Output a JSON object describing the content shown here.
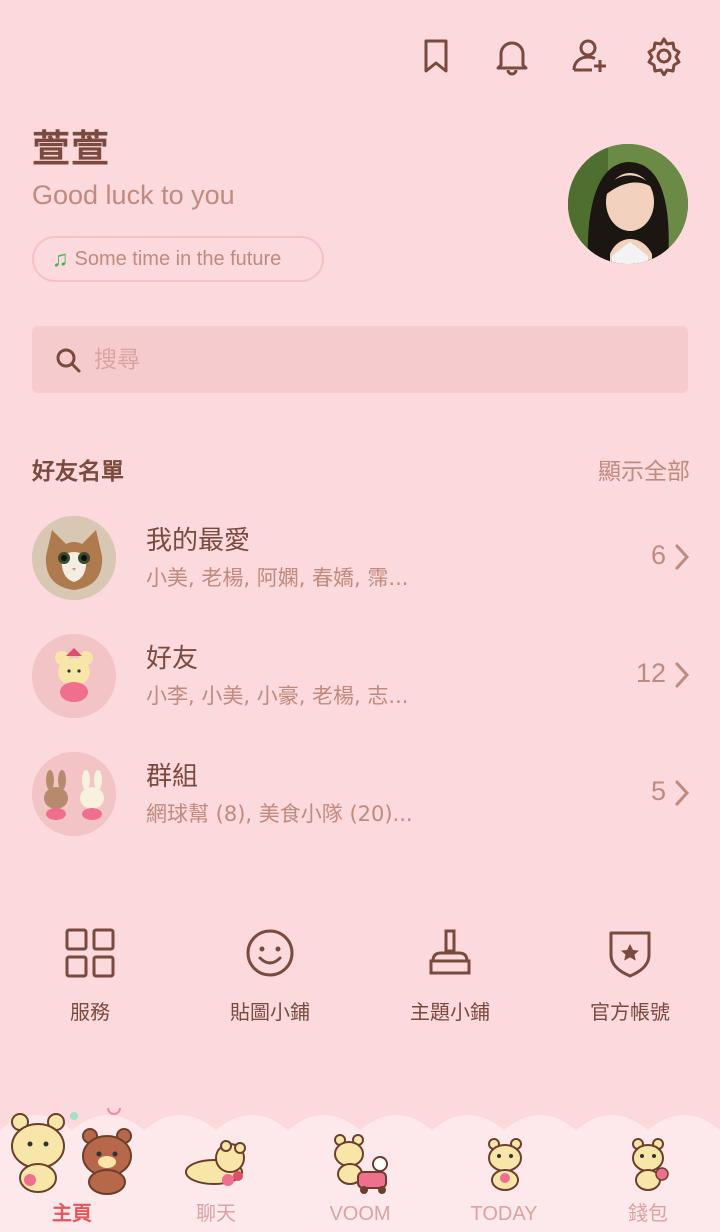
{
  "header": {
    "icons": [
      "bookmark-icon",
      "bell-icon",
      "add-friend-icon",
      "gear-icon"
    ]
  },
  "profile": {
    "name": "萱萱",
    "status": "Good luck to you",
    "music": "Some time in the future"
  },
  "search": {
    "placeholder": "搜尋"
  },
  "friends_section": {
    "title": "好友名單",
    "show_all": "顯示全部",
    "rows": [
      {
        "title": "我的最愛",
        "sub": "小美, 老楊, 阿嫻, 春嬌, 霈...",
        "count": "6"
      },
      {
        "title": "好友",
        "sub": "小李, 小美, 小豪, 老楊, 志...",
        "count": "12"
      },
      {
        "title": "群組",
        "sub": "網球幫 (8), 美食小隊 (20)...",
        "count": "5"
      }
    ]
  },
  "services": [
    {
      "label": "服務",
      "icon": "grid-icon"
    },
    {
      "label": "貼圖小鋪",
      "icon": "smile-icon"
    },
    {
      "label": "主題小鋪",
      "icon": "brush-icon"
    },
    {
      "label": "官方帳號",
      "icon": "shield-star-icon"
    }
  ],
  "bottom_nav": [
    {
      "label": "主頁",
      "active": true
    },
    {
      "label": "聊天",
      "active": false
    },
    {
      "label": "VOOM",
      "active": false
    },
    {
      "label": "TODAY",
      "active": false
    },
    {
      "label": "錢包",
      "active": false
    }
  ],
  "colors": {
    "background": "#fbd9dc",
    "text": "#7a4a3e",
    "muted": "#c08a7e",
    "active_tab": "#e2575a"
  }
}
